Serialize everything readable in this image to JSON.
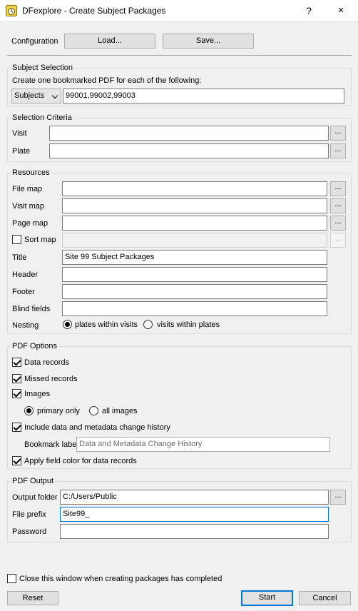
{
  "window": {
    "title": "DFexplore - Create Subject Packages",
    "help_glyph": "?",
    "close_glyph": "✕"
  },
  "config": {
    "label": "Configuration",
    "load": "Load...",
    "save": "Save..."
  },
  "subject_selection": {
    "title": "Subject Selection",
    "instruction": "Create one bookmarked PDF for each of the following:",
    "type": "Subjects",
    "ids": "99001,99002,99003"
  },
  "selection_criteria": {
    "title": "Selection Criteria",
    "visit_label": "Visit",
    "visit_value": "",
    "plate_label": "Plate",
    "plate_value": ""
  },
  "resources": {
    "title": "Resources",
    "file_map_label": "File map",
    "file_map_value": "",
    "visit_map_label": "Visit map",
    "visit_map_value": "",
    "page_map_label": "Page map",
    "page_map_value": "",
    "sort_map_label": "Sort map",
    "sort_map_checked": false,
    "sort_map_value": "",
    "title_label": "Title",
    "title_value": "Site 99 Subject Packages",
    "header_label": "Header",
    "header_value": "",
    "footer_label": "Footer",
    "footer_value": "",
    "blind_fields_label": "Blind fields",
    "blind_fields_value": "",
    "nesting_label": "Nesting",
    "nesting_options": [
      "plates within visits",
      "visits within plates"
    ],
    "nesting_selected": "plates within visits"
  },
  "pdf_options": {
    "title": "PDF Options",
    "data_records": "Data records",
    "data_records_checked": true,
    "missed_records": "Missed records",
    "missed_records_checked": true,
    "images": "Images",
    "images_checked": true,
    "image_options": [
      "primary only",
      "all images"
    ],
    "image_selected": "primary only",
    "history": "Include data and metadata change history",
    "history_checked": true,
    "bookmark_label": "Bookmark label",
    "bookmark_placeholder": "Data and Metadata Change History",
    "field_color": "Apply field color for data records",
    "field_color_checked": true
  },
  "pdf_output": {
    "title": "PDF Output",
    "folder_label": "Output folder",
    "folder_value": "C:/Users/Public",
    "prefix_label": "File prefix",
    "prefix_value": "Site99_",
    "password_label": "Password",
    "password_value": ""
  },
  "footer": {
    "close_when_done": "Close this window when creating packages has completed",
    "close_when_done_checked": false,
    "reset": "Reset",
    "start": "Start",
    "cancel": "Cancel"
  },
  "browse_glyph": "...",
  "colors": {
    "accent": "#0078d7",
    "background": "#f0f0f0"
  }
}
